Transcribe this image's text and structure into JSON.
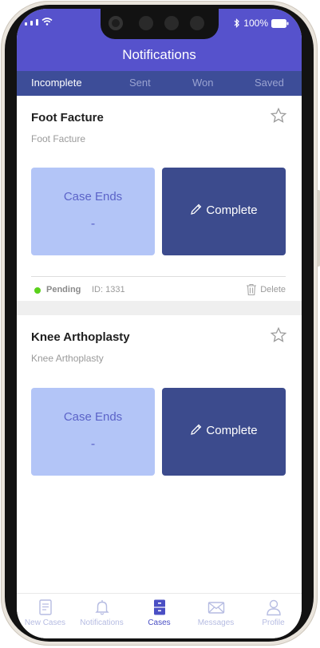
{
  "status": {
    "battery": "100%"
  },
  "header": {
    "title": "Notifications"
  },
  "tabs": [
    {
      "label": "Incomplete",
      "active": true
    },
    {
      "label": "Sent"
    },
    {
      "label": "Won"
    },
    {
      "label": "Saved"
    }
  ],
  "cards": [
    {
      "title": "Foot Facture",
      "subtitle": "Foot Facture",
      "case_ends_label": "Case Ends",
      "case_ends_value": "-",
      "complete_label": "Complete",
      "status": "Pending",
      "id": "ID: 1331",
      "delete_label": "Delete"
    },
    {
      "title": "Knee Arthoplasty",
      "subtitle": "Knee Arthoplasty",
      "case_ends_label": "Case Ends",
      "case_ends_value": "-",
      "complete_label": "Complete"
    }
  ],
  "bottom_nav": [
    {
      "label": "New Cases",
      "icon": "document-icon"
    },
    {
      "label": "Notifications",
      "icon": "bell-icon"
    },
    {
      "label": "Cases",
      "icon": "cabinet-icon",
      "active": true
    },
    {
      "label": "Messages",
      "icon": "envelope-icon"
    },
    {
      "label": "Profile",
      "icon": "person-icon"
    }
  ],
  "colors": {
    "header": "#5652cc",
    "tabs_bar": "#3d4d98",
    "case_ends_tile": "#b3c5f7",
    "complete_tile": "#3c4b8d",
    "pending_dot": "#5ad11b"
  }
}
